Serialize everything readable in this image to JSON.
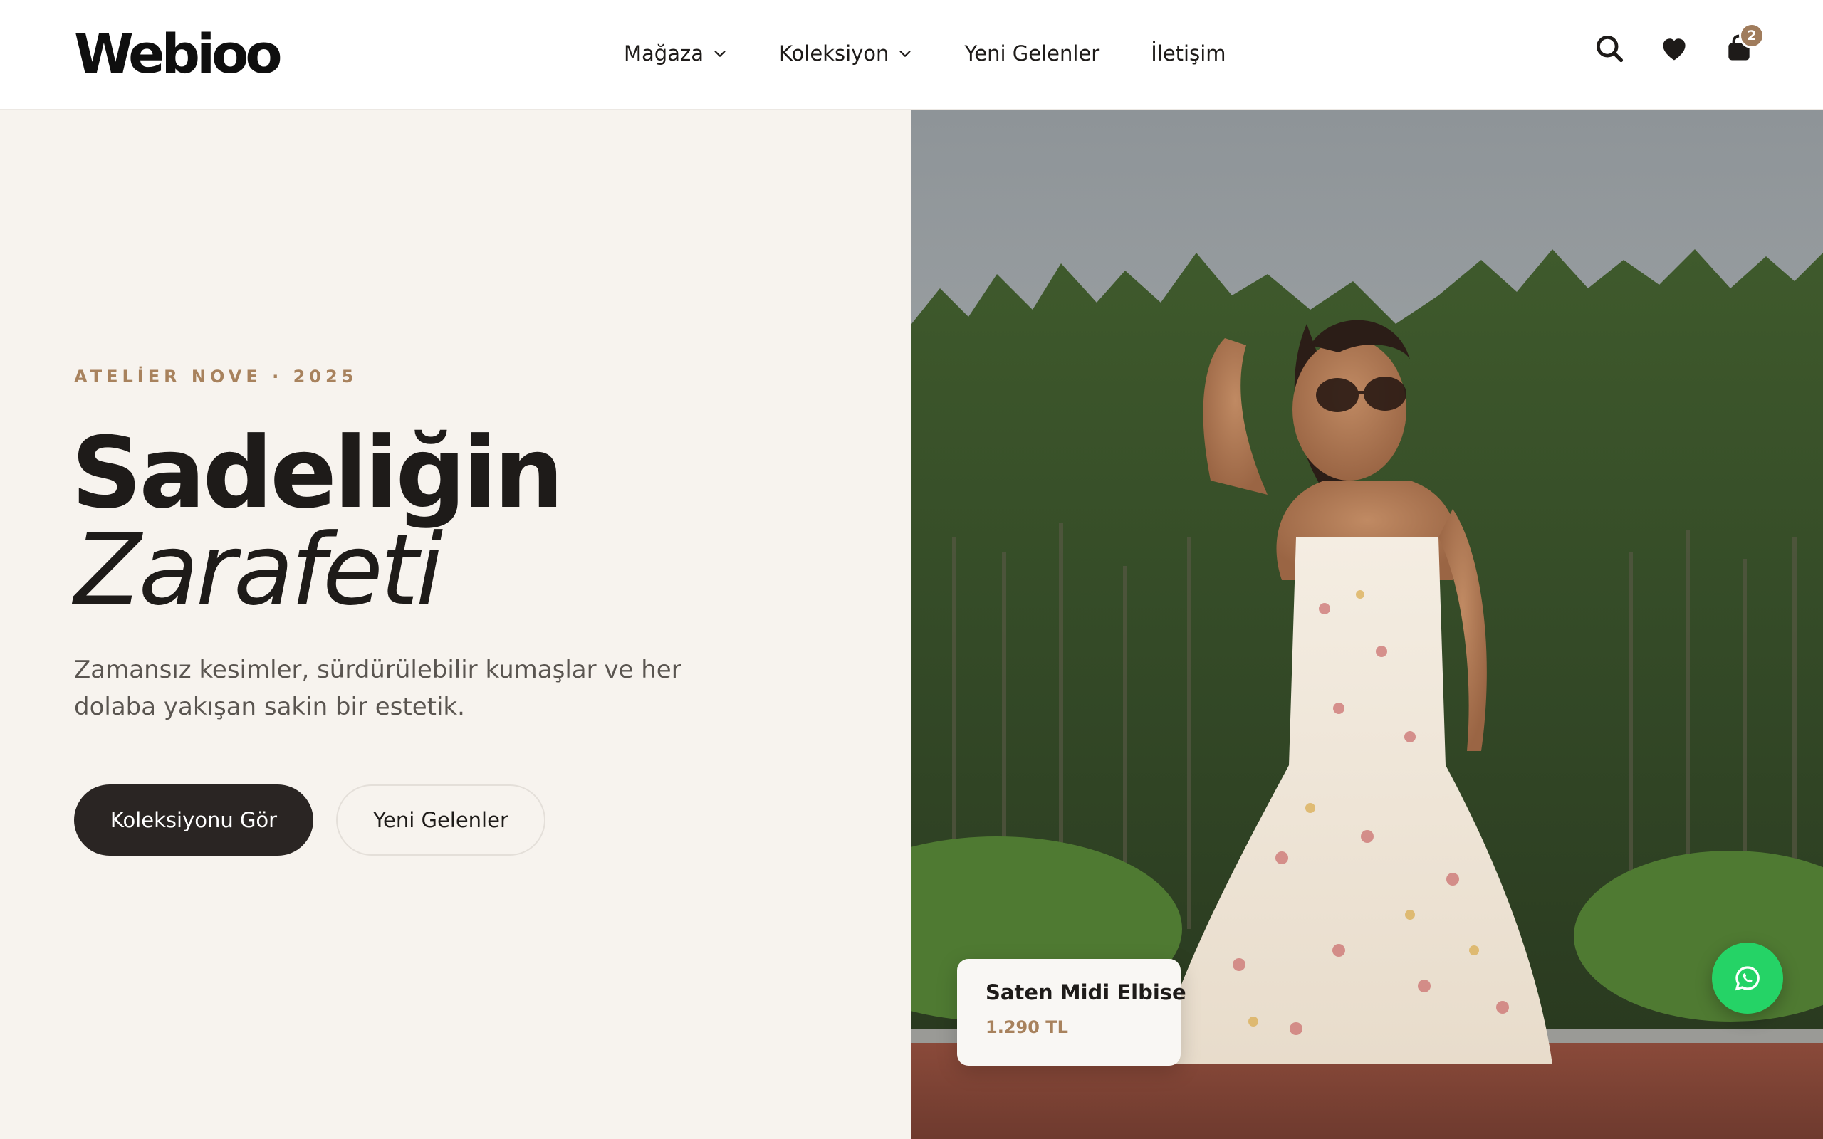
{
  "brand": {
    "logo_text": "Webioo"
  },
  "nav": {
    "items": [
      {
        "label": "Mağaza",
        "has_dropdown": true
      },
      {
        "label": "Koleksiyon",
        "has_dropdown": true
      },
      {
        "label": "Yeni Gelenler",
        "has_dropdown": false
      },
      {
        "label": "İletişim",
        "has_dropdown": false
      }
    ]
  },
  "header_icons": {
    "search": "search-icon",
    "wishlist": "heart-icon",
    "cart": "shopping-bag-icon",
    "cart_count": "2"
  },
  "hero": {
    "eyebrow": "ATELİER NOVE · 2025",
    "title_line1": "Sadeliğin",
    "title_line2": "Zarafeti",
    "description": "Zamansız kesimler, sürdürülebilir kumaşlar ve her dolaba yakışan sakin bir estetik.",
    "primary_button": "Koleksiyonu Gör",
    "secondary_button": "Yeni Gelenler"
  },
  "product_card": {
    "name": "Saten Midi Elbise",
    "price": "1.290 TL"
  },
  "floating": {
    "whatsapp": "whatsapp-icon"
  },
  "colors": {
    "background": "#f7f3ee",
    "accent": "#a8825d",
    "dark": "#2a2523",
    "whatsapp": "#25d366"
  }
}
